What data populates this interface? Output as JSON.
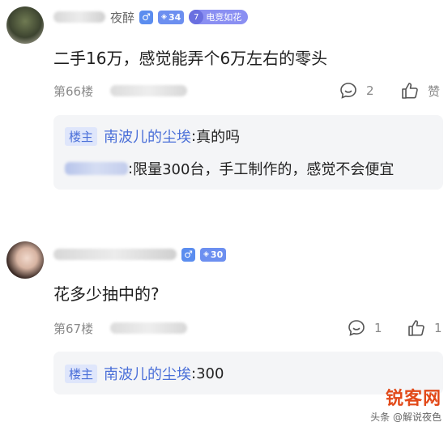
{
  "posts": [
    {
      "user_name_tail": "夜醉",
      "gender_symbol": "♂",
      "level": "34",
      "honor_level": "7",
      "honor_title": "电竞如花",
      "content": "二手16万，感觉能弄个6万左右的零头",
      "floor": "第66楼",
      "reply_count": "2",
      "like_label": "赞",
      "replies": [
        {
          "owner_tag": "楼主",
          "author": "南波儿的尘埃",
          "sep": ": ",
          "text": "真的吗"
        },
        {
          "sep": ": ",
          "text": "限量300台，手工制作的，感觉不会便宜"
        }
      ]
    },
    {
      "user_name_tail": "",
      "gender_symbol": "♂",
      "level": "30",
      "content": "花多少抽中的?",
      "floor": "第67楼",
      "reply_count": "1",
      "like_count": "1",
      "replies": [
        {
          "owner_tag": "楼主",
          "author": "南波儿的尘埃",
          "sep": ": ",
          "text": "300"
        }
      ]
    }
  ],
  "watermark": {
    "logo": "锐客网",
    "caption": "头条 @解说夜色"
  },
  "colors": {
    "accent_blue": "#4a6fd8",
    "badge_blue": "#6c8ff0",
    "watermark_red": "#e24a1a"
  }
}
